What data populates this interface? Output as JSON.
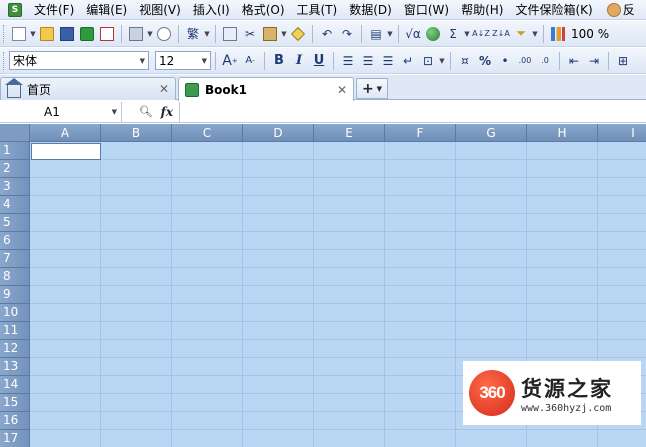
{
  "app": {
    "icon_label": "S"
  },
  "menu": {
    "items": [
      "文件(F)",
      "编辑(E)",
      "视图(V)",
      "插入(I)",
      "格式(O)",
      "工具(T)",
      "数据(D)",
      "窗口(W)",
      "帮助(H)",
      "文件保险箱(K)"
    ],
    "user_label": "反"
  },
  "toolbar": {
    "traditional_label": "繁",
    "sqrt_label": "√α",
    "sum_label": "Σ",
    "sort_asc_label": "A↓Z",
    "sort_desc_label": "Z↓A",
    "zoom": "100 %"
  },
  "format_toolbar": {
    "font_name": "宋体",
    "font_size": "12",
    "grow_font": "A",
    "shrink_font": "A",
    "bold": "B",
    "italic": "I",
    "underline": "U",
    "percent": "%",
    "comma": "•",
    "inc_decimal": ".00",
    "dec_decimal": ".0"
  },
  "tabs": [
    {
      "label": "首页"
    },
    {
      "label": "Book1"
    }
  ],
  "tab_add": "+",
  "formula_bar": {
    "cell_ref": "A1",
    "fx": "fx"
  },
  "sheet": {
    "columns": [
      "A",
      "B",
      "C",
      "D",
      "E",
      "F",
      "G",
      "H",
      "I"
    ],
    "rows": [
      "1",
      "2",
      "3",
      "4",
      "5",
      "6",
      "7",
      "8",
      "9",
      "10",
      "11",
      "12",
      "13",
      "14",
      "15",
      "16",
      "17"
    ],
    "selection_color": "#b9d7f5",
    "header_color": "#7e9cc2"
  },
  "watermark": {
    "badge": "360",
    "title": "货源之家",
    "url": "www.360hyzj.com"
  }
}
